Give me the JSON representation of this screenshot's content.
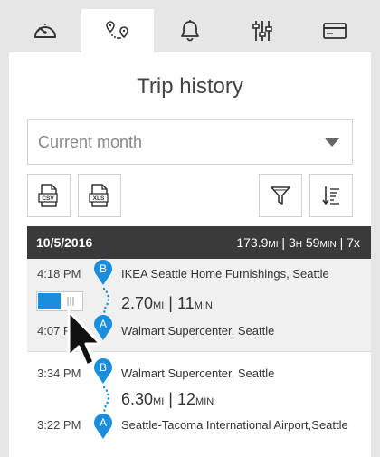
{
  "tabs": [
    {
      "icon": "speedometer-icon",
      "active": false
    },
    {
      "icon": "route-icon",
      "active": true
    },
    {
      "icon": "bell-icon",
      "active": false
    },
    {
      "icon": "sliders-icon",
      "active": false
    },
    {
      "icon": "credit-card-icon",
      "active": false
    }
  ],
  "page": {
    "title": "Trip history"
  },
  "period_select": {
    "value": "Current month"
  },
  "toolbar": {
    "csv_label": "CSV",
    "xls_label": "XLS"
  },
  "day": {
    "date": "10/5/2016",
    "distance": "173.9",
    "distance_unit": "mi",
    "sep1": "|",
    "duration_h": "3",
    "duration_h_unit": "H",
    "duration_m": "59",
    "duration_m_unit": "min",
    "sep2": "|",
    "count": "7x"
  },
  "trips": [
    {
      "end_time": "4:18 PM",
      "start_time": "4:07 PM",
      "end_place": "IKEA Seattle Home Furnishings, Seattle",
      "start_place": "Walmart Supercenter, Seattle",
      "distance": "2.70",
      "distance_unit": "mi",
      "sep": "|",
      "duration": "11",
      "duration_unit": "min",
      "end_marker": "B",
      "start_marker": "A"
    },
    {
      "end_time": "3:34 PM",
      "start_time": "3:22 PM",
      "end_place": "Walmart Supercenter, Seattle",
      "start_place": "Seattle-Tacoma International Airport,Seattle",
      "distance": "6.30",
      "distance_unit": "mi",
      "sep": "|",
      "duration": "12",
      "duration_unit": "min",
      "end_marker": "B",
      "start_marker": "A"
    }
  ],
  "colors": {
    "accent": "#1a8ddb",
    "header_bg": "#3a3a3a",
    "page_bg": "#e6e6e6"
  }
}
